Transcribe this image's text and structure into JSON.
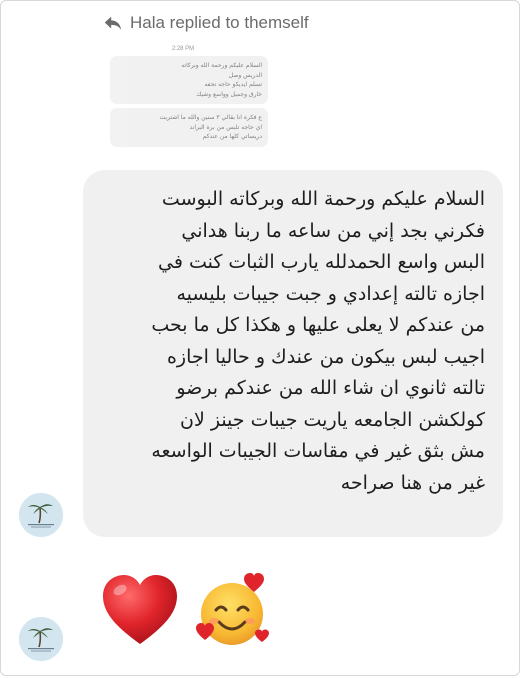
{
  "header": {
    "reply_label": "Hala replied to themself",
    "reply_icon": "reply-arrow-icon"
  },
  "quoted": {
    "time": "2:28 PM",
    "message1_lines": [
      "السلام عليكم ورحمة الله وبركاته",
      "الدريس وصل",
      "تسلم ايديكو حاجه تحفه",
      "خارق وجميل وواسع وشيك"
    ],
    "message2_lines": [
      "ع فكره انا بقالي ٣ سنين والله ما اشتريت",
      "اي حاجه تلبس من بره البراند",
      "دريساتي كلها من عندكم"
    ]
  },
  "message": {
    "lines": [
      "السلام عليكم  ورحمة الله وبركاته البوست",
      "فكرني بجد إني من ساعه ما ربنا هداني",
      "البس واسع الحمدلله يارب الثبات كنت في",
      "اجازه تالته إعدادي و جبت جيبات بليسيه",
      "من عندكم لا يعلى عليها و هكذا كل ما بحب",
      "اجيب لبس بيكون من عندك و حاليا اجازه",
      "تالته ثانوي ان شاء الله من عندكم برضو",
      "كولكشن الجامعه ياريت جيبات جينز لان",
      "مش بثق غير في مقاسات الجيبات الواسعه",
      "غير من هنا صراحه"
    ]
  },
  "reactions": [
    "red-heart-emoji",
    "smiling-face-with-hearts-emoji"
  ],
  "colors": {
    "bubble": "#f0f0f1",
    "header_text": "#6b6b6b",
    "heart": "#e0242b",
    "face": "#f7b731"
  }
}
